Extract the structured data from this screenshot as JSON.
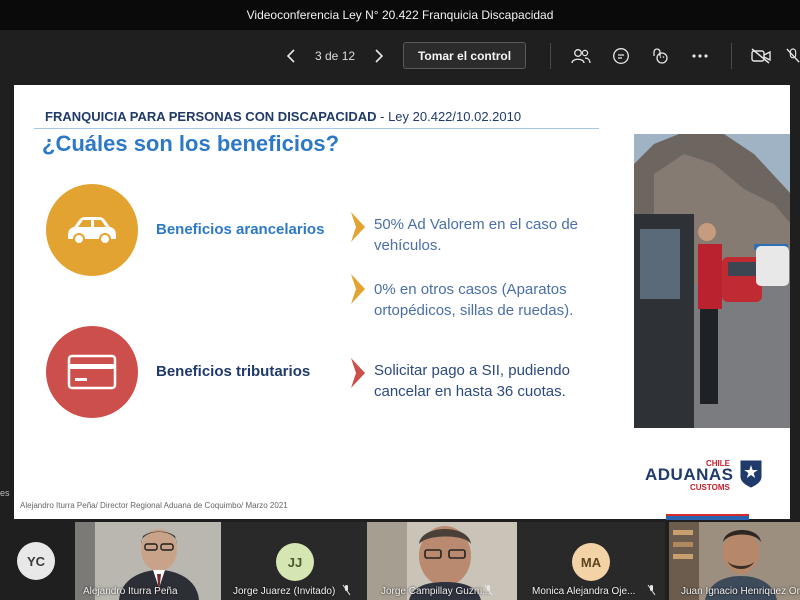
{
  "window": {
    "title": "Videoconferencia Ley N° 20.422 Franquicia Discapacidad"
  },
  "toolbar": {
    "page_counter": "3 de 12",
    "take_control_label": "Tomar el control",
    "icons": [
      "chevron-left-icon",
      "chevron-right-icon",
      "people-icon",
      "chat-icon",
      "reactions-icon",
      "more-icon",
      "camera-off-icon",
      "mic-off-icon"
    ]
  },
  "side_fragment": "es",
  "slide": {
    "header_bold": "FRANQUICIA PARA PERSONAS CON DISCAPACIDAD",
    "header_law": " - Ley 20.422/10.02.2010",
    "title": "¿Cuáles son los beneficios?",
    "benefit_arancelarios": "Beneficios arancelarios",
    "benefit_tributarios": "Beneficios tributarios",
    "bullet_1": "50% Ad Valorem en el caso de vehículos.",
    "bullet_2": "0% en otros casos (Aparatos ortopédicos, sillas de ruedas).",
    "bullet_3": "Solicitar pago a SII, pudiendo cancelar en hasta 36 cuotas.",
    "logo": {
      "chile": "CHILE",
      "aduanas": "ADUANAS",
      "customs": "CUSTOMS"
    },
    "footer": "Alejandro Iturra Peña/ Director Regional Aduana de Coquimbo/ Marzo 2021",
    "colors": {
      "accent_blue": "#2d79c7",
      "navy": "#1f3a6b",
      "gold": "#e3a330",
      "red": "#cd4f4b"
    }
  },
  "participants": [
    {
      "initials": "YC",
      "name": ""
    },
    {
      "initials": "",
      "name": "Alejandro Iturra Peña"
    },
    {
      "initials": "JJ",
      "name": "Jorge Juarez (Invitado)"
    },
    {
      "initials": "",
      "name": "Jorge Campillay Guzm..."
    },
    {
      "initials": "MA",
      "name": "Monica Alejandra Oje..."
    },
    {
      "initials": "",
      "name": "Juan Ignacio Henriquez Or..."
    }
  ]
}
